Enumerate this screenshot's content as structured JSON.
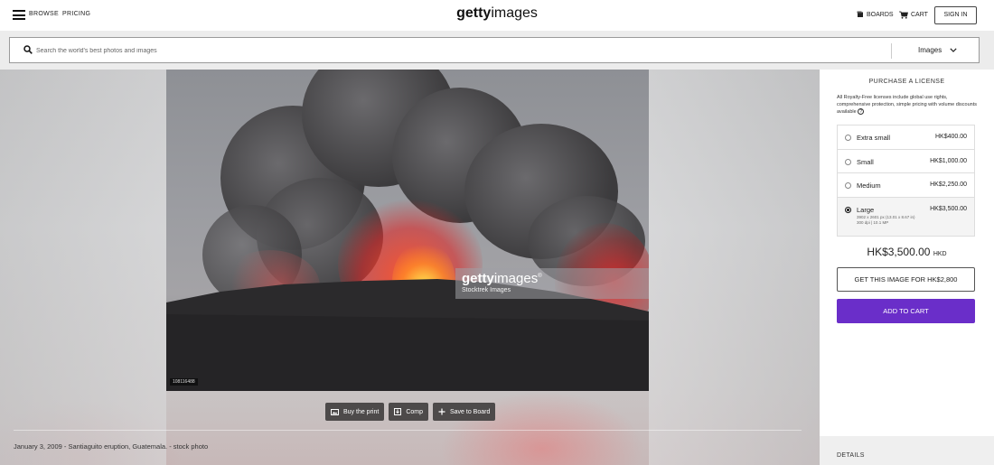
{
  "header": {
    "browse": "BROWSE",
    "pricing": "PRICING",
    "logo_bold": "getty",
    "logo_light": "images",
    "boards": "BOARDS",
    "cart": "CART",
    "sign_in": "SIGN IN"
  },
  "search": {
    "placeholder": "Search the world's best photos and images",
    "type": "Images"
  },
  "image": {
    "id": "108116488",
    "watermark_bold": "getty",
    "watermark_light": "images",
    "watermark_mark": "®",
    "watermark_credit": "Stocktrek Images",
    "caption": "January 3, 2009 - Santiaguito eruption, Guatemala. - stock photo"
  },
  "actions": {
    "buy_print": "Buy the print",
    "comp": "Comp",
    "save": "Save to Board"
  },
  "license_panel": {
    "title": "PURCHASE A LICENSE",
    "note": "All Royalty-Free licenses include global use rights, comprehensive protection, simple pricing with volume discounts available",
    "options": [
      {
        "name": "Extra small",
        "price": "HK$400.00",
        "selected": false
      },
      {
        "name": "Small",
        "price": "HK$1,000.00",
        "selected": false
      },
      {
        "name": "Medium",
        "price": "HK$2,250.00",
        "selected": false
      },
      {
        "name": "Large",
        "price": "HK$3,500.00",
        "selected": true,
        "detail1": "3902 x 2601 px (13.01 x 8.67 in)",
        "detail2": "300 dpi | 10.1 MP"
      }
    ],
    "total": "HK$3,500.00",
    "currency": "HKD",
    "get_image": "GET THIS IMAGE FOR HK$2,800",
    "add_to_cart": "ADD TO CART",
    "details": "DETAILS"
  },
  "colors": {
    "accent": "#6a2ec9",
    "action_button": "#4d4a4a"
  }
}
